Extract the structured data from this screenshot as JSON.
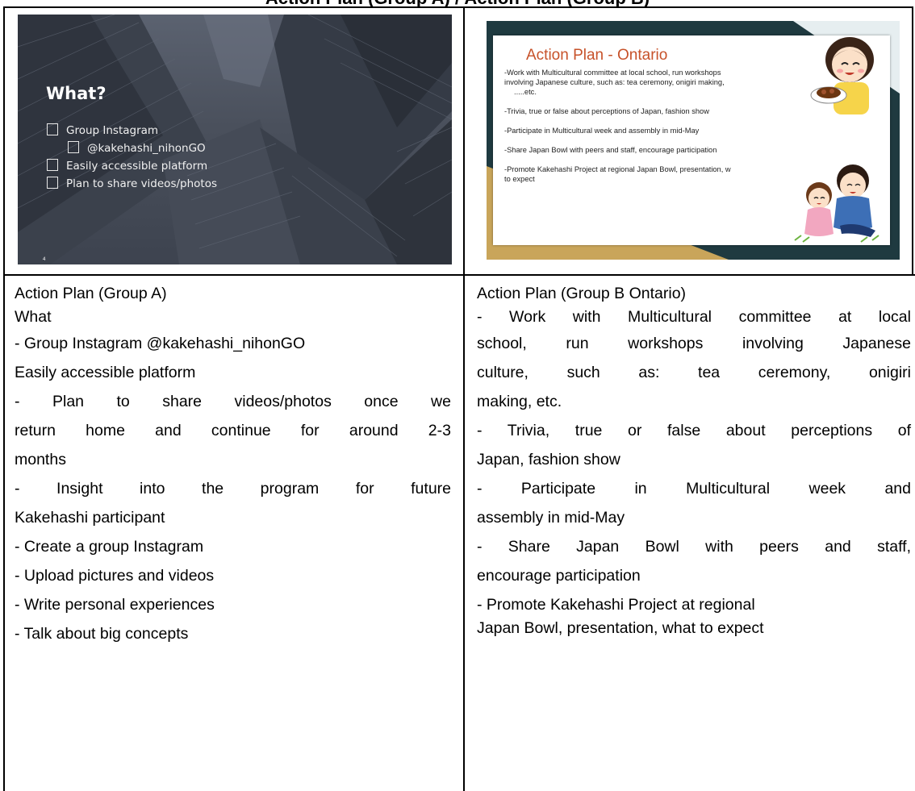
{
  "page": {
    "title": "Action Plan (Group A) / Action Plan (Group B)"
  },
  "slide_a": {
    "heading": "What?",
    "bullets": [
      {
        "text": "Group Instagram",
        "level": 1
      },
      {
        "text": "@kakehashi_nihonGO",
        "level": 2
      },
      {
        "text": "Easily accessible platform",
        "level": 1
      },
      {
        "text": "Plan to share videos/photos",
        "level": 1
      }
    ],
    "page_number": "4"
  },
  "slide_b": {
    "title": "Action Plan - Ontario",
    "lines": [
      "-Work with Multicultural committee at local school, run workshops",
      "involving Japanese culture, such as: tea ceremony, onigiri making,",
      ".....etc.",
      "-Trivia, true or false about perceptions of Japan, fashion show",
      "-Participate in Multicultural week and assembly in mid-May",
      "-Share Japan Bowl with peers and staff, encourage participation",
      "-Promote Kakehashi Project at regional Japan Bowl, presentation, w",
      "to expect"
    ]
  },
  "left_text": {
    "lines": [
      "Action Plan (Group A)",
      "What",
      "- Group Instagram    @kakehashi_nihonGO",
      "Easily accessible platform",
      "- Plan to share videos/photos once we",
      "return home and continue for around 2-3",
      "months",
      "- Insight into the program for future",
      "Kakehashi participant",
      "- Create a group Instagram",
      "- Upload pictures and videos",
      "- Write personal experiences",
      "- Talk about big concepts"
    ]
  },
  "right_text": {
    "lines": [
      "Action Plan (Group B Ontario)",
      "- Work with Multicultural committee at local",
      "school, run workshops involving Japanese",
      "culture, such as: tea ceremony, onigiri",
      "making, etc.",
      "- Trivia, true or false about perceptions of",
      "Japan, fashion show",
      "- Participate in Multicultural week and",
      "assembly in mid-May",
      "- Share Japan Bowl with peers and staff,",
      "encourage participation",
      "- Promote Kakehashi Project at regional",
      "Japan Bowl, presentation, what to expect"
    ]
  }
}
